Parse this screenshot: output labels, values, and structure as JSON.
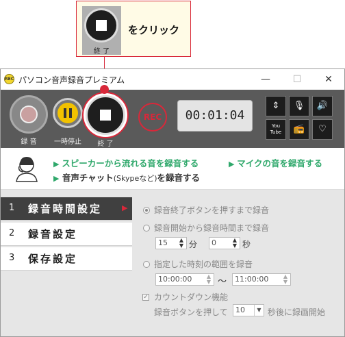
{
  "callout": {
    "thumb_label": "終 了",
    "text": "をクリック"
  },
  "window": {
    "app_icon_text": "REC",
    "title": "パソコン音声録音プレミアム",
    "minimize": "—",
    "maximize": "☐",
    "close": "✕"
  },
  "toolbar": {
    "record_label": "録 音",
    "pause_label": "一時停止",
    "stop_label": "終 了",
    "rec_badge": "REC",
    "timer": "00:01:04",
    "tool_icons": [
      "resize-icon",
      "microphone-icon",
      "speaker-icon",
      "youtube-icon",
      "radio-icon",
      "headset-icon"
    ],
    "youtube_text": "You Tube"
  },
  "info": {
    "link1": "スピーカーから流れる音を録音する",
    "link2": "マイクの音を録音する",
    "link3_main": "音声チャット",
    "link3_paren": "(Skypeなど)",
    "link3_tail": "を録音する"
  },
  "sidebar": {
    "items": [
      {
        "num": "1",
        "label": "録音時間設定",
        "active": true
      },
      {
        "num": "2",
        "label": "録音設定",
        "active": false
      },
      {
        "num": "3",
        "label": "保存設定",
        "active": false
      }
    ]
  },
  "settings": {
    "opt1": "録音終了ボタンを押すまで録音",
    "opt2": "録音開始から録音時間まで録音",
    "min_value": "15",
    "min_unit": "分",
    "sec_value": "0",
    "sec_unit": "秒",
    "opt3": "指定した時刻の範囲を録音",
    "time_start": "10:00:00",
    "time_sep": "〜",
    "time_end": "11:00:00",
    "countdown_label": "カウントダウン機能",
    "countdown_prefix": "録音ボタンを押して",
    "countdown_value": "10",
    "countdown_suffix": "秒後に録画開始"
  },
  "colors": {
    "accent_red": "#d8283a",
    "toolbar": "#5a5a5a",
    "link_green": "#2fa86b",
    "pause_yellow": "#f2c200"
  }
}
